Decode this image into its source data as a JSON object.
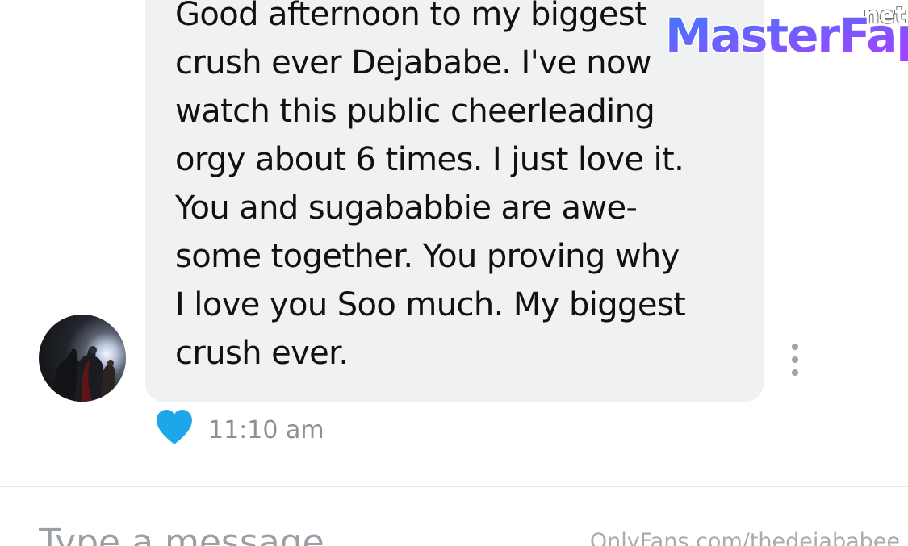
{
  "message": {
    "lines": [
      "Good afternoon to my biggest",
      "crush ever Dejababe. I've now",
      "watch this public cheerleading",
      "orgy about 6 times. I just love it.",
      "You and sugababbie are awe-",
      "some together. You proving why",
      "I love you Soo much. My biggest",
      "crush ever."
    ],
    "time": "11:10 am",
    "liked": true
  },
  "composer": {
    "placeholder": "Type a message"
  },
  "watermark": {
    "site_logo": {
      "main": "MasterFap",
      "suffix": ".net"
    },
    "footer_text": "OnlyFans.com/thedejababee"
  },
  "colors": {
    "bubble": "#eff1f2",
    "heart": "#1ea7e8",
    "timestamp": "#8a9198",
    "text": "#111111",
    "logo_gradient": [
      "#3b7bff",
      "#b03cff"
    ]
  },
  "icons": {
    "like": "heart-icon",
    "menu": "more-vertical-icon",
    "avatar": "avatar-image"
  }
}
